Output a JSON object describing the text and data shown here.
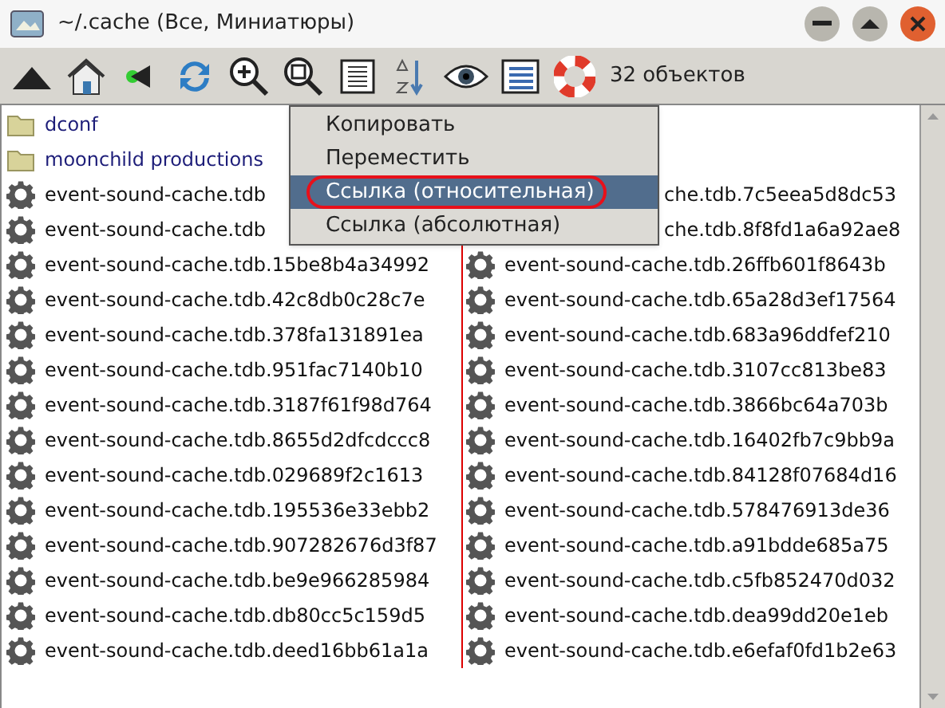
{
  "window": {
    "title": "~/.cache (Все, Миниатюры)"
  },
  "toolbar": {
    "status": "32 объектов"
  },
  "files": {
    "columns": [
      [
        {
          "name": "dconf",
          "kind": "folder"
        },
        {
          "name": "moonchild productions",
          "kind": "folder"
        },
        {
          "name": "event-sound-cache.tdb",
          "kind": "file"
        },
        {
          "name": "event-sound-cache.tdb",
          "kind": "file"
        },
        {
          "name": "event-sound-cache.tdb.15be8b4a34992",
          "kind": "file"
        },
        {
          "name": "event-sound-cache.tdb.42c8db0c28c7e",
          "kind": "file"
        },
        {
          "name": "event-sound-cache.tdb.378fa131891ea",
          "kind": "file"
        },
        {
          "name": "event-sound-cache.tdb.951fac7140b10",
          "kind": "file"
        },
        {
          "name": "event-sound-cache.tdb.3187f61f98d764",
          "kind": "file"
        },
        {
          "name": "event-sound-cache.tdb.8655d2dfcdccc8",
          "kind": "file"
        },
        {
          "name": "event-sound-cache.tdb.029689f2c1613",
          "kind": "file"
        },
        {
          "name": "event-sound-cache.tdb.195536e33ebb2",
          "kind": "file"
        },
        {
          "name": "event-sound-cache.tdb.907282676d3f87",
          "kind": "file"
        },
        {
          "name": "event-sound-cache.tdb.be9e966285984",
          "kind": "file"
        },
        {
          "name": "event-sound-cache.tdb.db80cc5c159d5",
          "kind": "file"
        },
        {
          "name": "event-sound-cache.tdb.deed16bb61a1a",
          "kind": "file"
        }
      ],
      [
        {
          "name": "che.tdb.7c5eea5d8dc53",
          "kind": "clipped"
        },
        {
          "name": "che.tdb.8f8fd1a6a92ae8",
          "kind": "clipped"
        },
        {
          "name": "event-sound-cache.tdb.26ffb601f8643b",
          "kind": "file"
        },
        {
          "name": "event-sound-cache.tdb.65a28d3ef17564",
          "kind": "file"
        },
        {
          "name": "event-sound-cache.tdb.683a96ddfef210",
          "kind": "file"
        },
        {
          "name": "event-sound-cache.tdb.3107cc813be83",
          "kind": "file"
        },
        {
          "name": "event-sound-cache.tdb.3866bc64a703b",
          "kind": "file"
        },
        {
          "name": "event-sound-cache.tdb.16402fb7c9bb9a",
          "kind": "file"
        },
        {
          "name": "event-sound-cache.tdb.84128f07684d16",
          "kind": "file"
        },
        {
          "name": "event-sound-cache.tdb.578476913de36",
          "kind": "file"
        },
        {
          "name": "event-sound-cache.tdb.a91bdde685a75",
          "kind": "file"
        },
        {
          "name": "event-sound-cache.tdb.c5fb852470d032",
          "kind": "file"
        },
        {
          "name": "event-sound-cache.tdb.dea99dd20e1eb",
          "kind": "file"
        },
        {
          "name": "event-sound-cache.tdb.e6efaf0fd1b2e63",
          "kind": "file"
        }
      ]
    ]
  },
  "context_menu": {
    "items": [
      {
        "label": "Копировать",
        "selected": false
      },
      {
        "label": "Переместить",
        "selected": false
      },
      {
        "label": "Ссылка (относительная)",
        "selected": true,
        "circled": true
      },
      {
        "label": "Ссылка (абсолютная)",
        "selected": false,
        "circled": false
      }
    ]
  }
}
